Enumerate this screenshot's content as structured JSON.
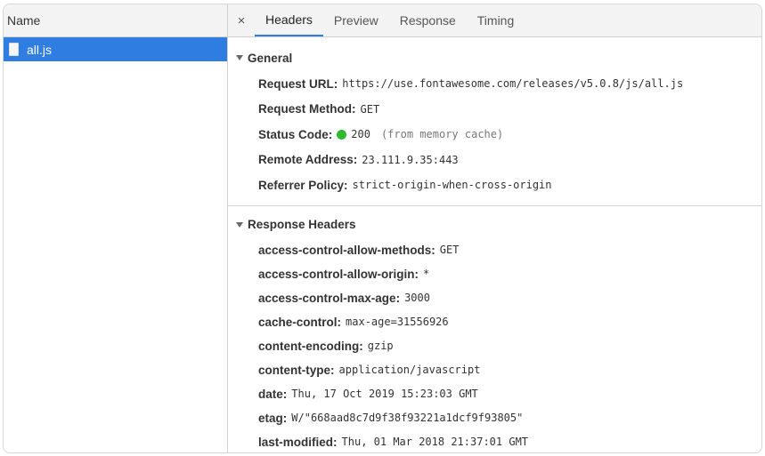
{
  "left": {
    "header": "Name",
    "files": [
      {
        "name": "all.js"
      }
    ]
  },
  "tabs": {
    "close": "×",
    "items": [
      "Headers",
      "Preview",
      "Response",
      "Timing"
    ],
    "active": "Headers"
  },
  "general": {
    "title": "General",
    "request_url": {
      "key": "Request URL:",
      "value": "https://use.fontawesome.com/releases/v5.0.8/js/all.js"
    },
    "request_method": {
      "key": "Request Method:",
      "value": "GET"
    },
    "status_code": {
      "key": "Status Code:",
      "value": "200",
      "note": "(from memory cache)",
      "color": "#2fb92f"
    },
    "remote_address": {
      "key": "Remote Address:",
      "value": "23.111.9.35:443"
    },
    "referrer_policy": {
      "key": "Referrer Policy:",
      "value": "strict-origin-when-cross-origin"
    }
  },
  "response_headers": {
    "title": "Response Headers",
    "items": [
      {
        "key": "access-control-allow-methods:",
        "value": "GET"
      },
      {
        "key": "access-control-allow-origin:",
        "value": "*"
      },
      {
        "key": "access-control-max-age:",
        "value": "3000"
      },
      {
        "key": "cache-control:",
        "value": "max-age=31556926"
      },
      {
        "key": "content-encoding:",
        "value": "gzip"
      },
      {
        "key": "content-type:",
        "value": "application/javascript"
      },
      {
        "key": "date:",
        "value": "Thu, 17 Oct 2019 15:23:03 GMT"
      },
      {
        "key": "etag:",
        "value": "W/\"668aad8c7d9f38f93221a1dcf9f93805\""
      },
      {
        "key": "last-modified:",
        "value": "Thu, 01 Mar 2018 21:37:01 GMT"
      }
    ]
  },
  "colors": {
    "accent": "#2f7de1",
    "status_ok": "#2fb92f"
  }
}
